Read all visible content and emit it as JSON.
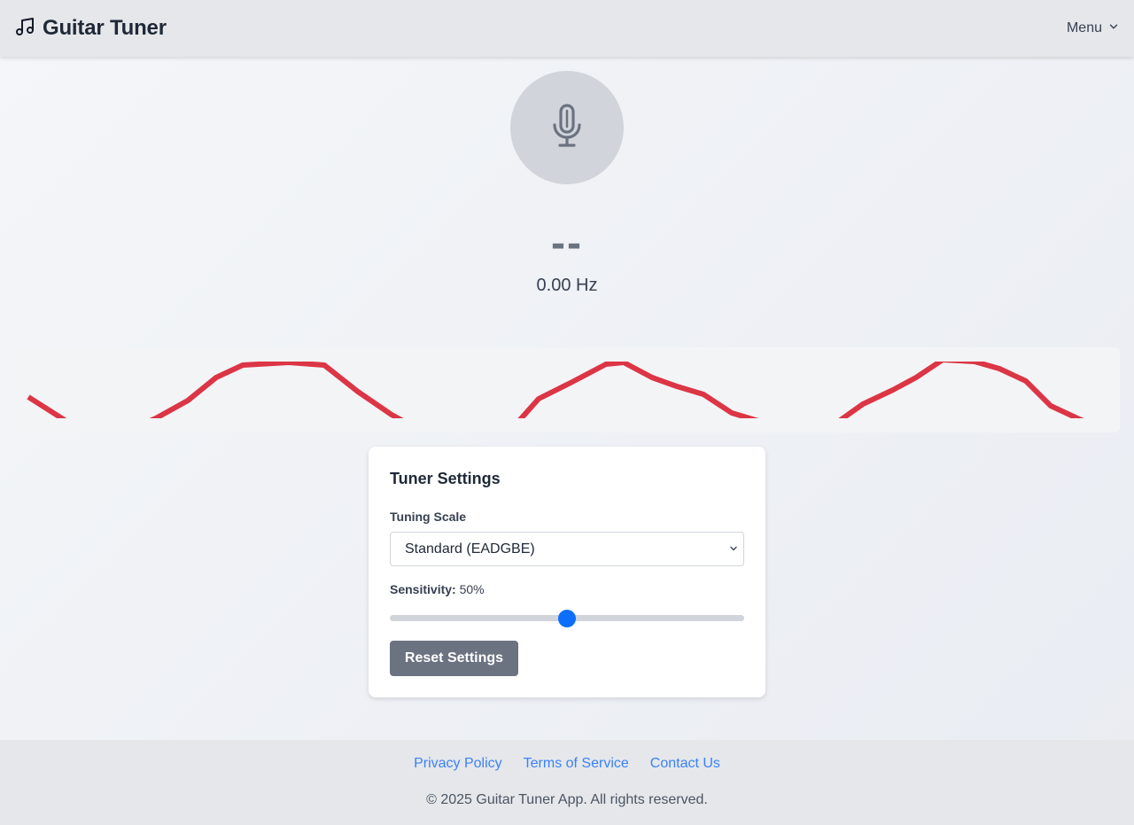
{
  "header": {
    "title": "Guitar Tuner",
    "brand_icon": "music-note-icon",
    "menu_label": "Menu",
    "menu_icon": "chevron-down-icon"
  },
  "tuner": {
    "mic_icon": "microphone-icon",
    "note": "--",
    "frequency": "0.00 Hz",
    "wave_color": "#dc3545"
  },
  "settings": {
    "title": "Tuner Settings",
    "scale_label": "Tuning Scale",
    "scale_value": "Standard (EADGBE)",
    "sensitivity_label": "Sensitivity:",
    "sensitivity_value": "50%",
    "sensitivity_fraction": 0.5,
    "reset_label": "Reset Settings",
    "accent_color": "#0d6efd"
  },
  "footer": {
    "links": [
      "Privacy Policy",
      "Terms of Service",
      "Contact Us"
    ],
    "copyright": "© 2025 Guitar Tuner App. All rights reserved."
  }
}
